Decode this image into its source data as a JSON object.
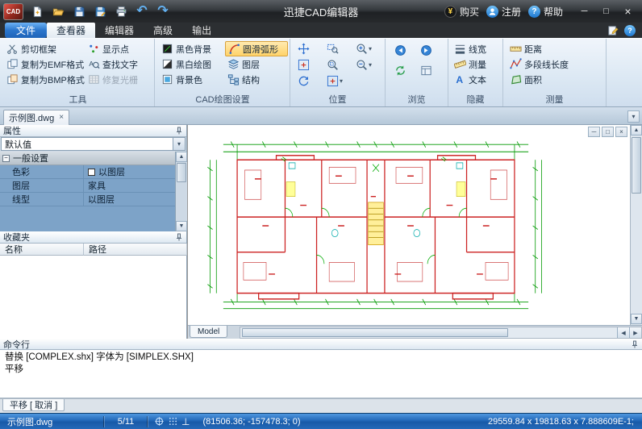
{
  "icons": {
    "minimize": "─",
    "maximize": "□",
    "close": "×",
    "dropdown": "▾",
    "tab_close": "×",
    "up": "▲",
    "down": "▼",
    "left": "◀",
    "right": "▶",
    "help": "?",
    "yen": "¥",
    "ortho": "⊥",
    "expander": "−",
    "undo": "↶",
    "redo": "↷",
    "letter_a": "A"
  },
  "colors": {
    "ribbon_highlight": "#ffd369",
    "statusbar_blue": "#2268b8",
    "grid_selection": "#7da3c8",
    "dim_green": "#009900",
    "wall_red": "#cc2222"
  },
  "titlebar": {
    "logo": "CAD",
    "title": "迅捷CAD编辑器",
    "buy": "购买",
    "register": "注册",
    "help": "帮助"
  },
  "menubar": {
    "file": "文件",
    "tabs": [
      "查看器",
      "编辑器",
      "高级",
      "输出"
    ]
  },
  "ribbon": {
    "tools": {
      "label": "工具",
      "buttons": [
        "剪切框架",
        "复制为EMF格式",
        "复制为BMP格式",
        "显示点",
        "查找文字",
        "修复光栅"
      ]
    },
    "cad": {
      "label": "CAD绘图设置",
      "buttons": [
        "黑色背景",
        "黑白绘图",
        "背景色",
        "圆滑弧形",
        "图层",
        "结构"
      ]
    },
    "position": {
      "label": "位置"
    },
    "browse": {
      "label": "浏览"
    },
    "hide": {
      "label": "隐藏",
      "buttons": [
        "线宽",
        "测量",
        "文本"
      ]
    },
    "measure": {
      "label": "测量",
      "buttons": [
        "距离",
        "多段线长度",
        "面积"
      ]
    }
  },
  "docstrip": {
    "tab": "示例图.dwg"
  },
  "properties": {
    "title": "属性",
    "preset": "默认值",
    "group": "一般设置",
    "rows": [
      {
        "name": "色彩",
        "value": "以图层"
      },
      {
        "name": "图层",
        "value": "家具"
      },
      {
        "name": "线型",
        "value": "以图层"
      }
    ]
  },
  "favorites": {
    "title": "收藏夹",
    "col_name": "名称",
    "col_path": "路径"
  },
  "canvas": {
    "model_tab": "Model"
  },
  "command": {
    "title": "命令行",
    "line1": "替换 [COMPLEX.shx] 字体为 [SIMPLEX.SHX]",
    "line2": "平移",
    "bottom_tab": "平移 [ 取消 ]"
  },
  "statusbar": {
    "file": "示例图.dwg",
    "page": "5/11",
    "coords": "(81506.36; -157478.3; 0)",
    "dims": "29559.84 x 19818.63 x 7.888609E-1;"
  }
}
